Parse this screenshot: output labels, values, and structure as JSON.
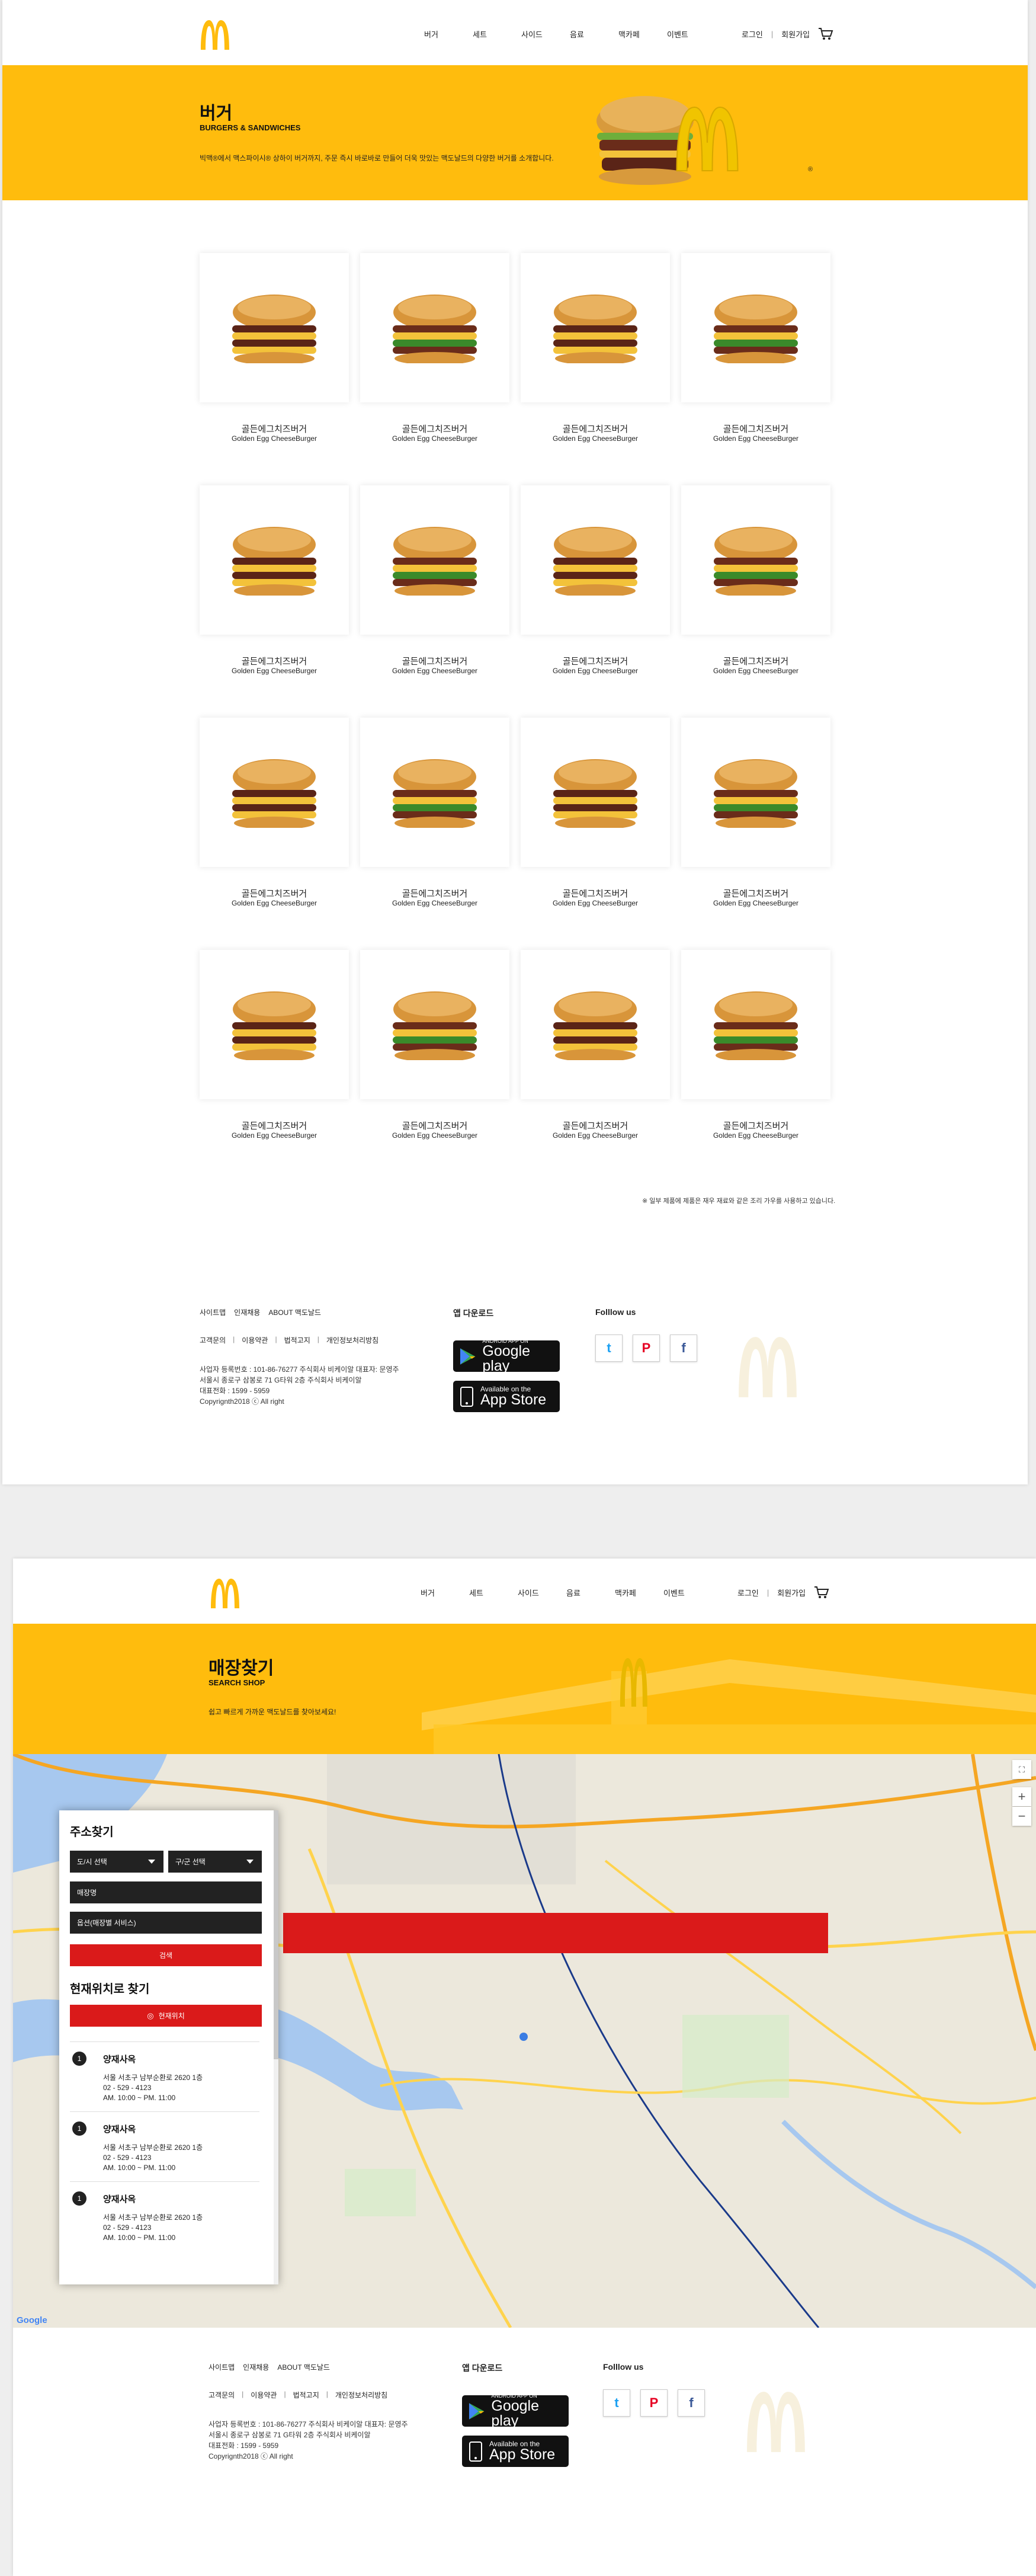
{
  "brand": {
    "yellow": "#ffbc0d",
    "red": "#da1a1a",
    "logo": "golden-arches-logo"
  },
  "nav": [
    "버거",
    "세트",
    "사이드",
    "음료",
    "맥카페",
    "이벤트"
  ],
  "util": {
    "login": "로그인",
    "signup": "회원가입",
    "cart_icon": "cart-icon"
  },
  "menu_page": {
    "hero": {
      "title": "버거",
      "subtitle": "BURGERS & SANDWICHES",
      "desc": "빅맥®에서 맥스파이시® 상하이 버거까지, 주문 즉시 바로바로 만들어 더욱 맛있는 맥도날드의 다양한 버거를 소개합니다."
    },
    "products": [
      {
        "kr": "골든에그치즈버거",
        "en": "Golden Egg CheeseBurger"
      },
      {
        "kr": "골든에그치즈버거",
        "en": "Golden Egg CheeseBurger"
      },
      {
        "kr": "골든에그치즈버거",
        "en": "Golden Egg CheeseBurger"
      },
      {
        "kr": "골든에그치즈버거",
        "en": "Golden Egg CheeseBurger"
      },
      {
        "kr": "골든에그치즈버거",
        "en": "Golden Egg CheeseBurger"
      },
      {
        "kr": "골든에그치즈버거",
        "en": "Golden Egg CheeseBurger"
      },
      {
        "kr": "골든에그치즈버거",
        "en": "Golden Egg CheeseBurger"
      },
      {
        "kr": "골든에그치즈버거",
        "en": "Golden Egg CheeseBurger"
      },
      {
        "kr": "골든에그치즈버거",
        "en": "Golden Egg CheeseBurger"
      },
      {
        "kr": "골든에그치즈버거",
        "en": "Golden Egg CheeseBurger"
      },
      {
        "kr": "골든에그치즈버거",
        "en": "Golden Egg CheeseBurger"
      },
      {
        "kr": "골든에그치즈버거",
        "en": "Golden Egg CheeseBurger"
      },
      {
        "kr": "골든에그치즈버거",
        "en": "Golden Egg CheeseBurger"
      },
      {
        "kr": "골든에그치즈버거",
        "en": "Golden Egg CheeseBurger"
      },
      {
        "kr": "골든에그치즈버거",
        "en": "Golden Egg CheeseBurger"
      },
      {
        "kr": "골든에그치즈버거",
        "en": "Golden Egg CheeseBurger"
      }
    ],
    "note": "※ 일부 제품에 제품은 재우 재료와 같은 조리 가우를 사용하고 있습니다."
  },
  "store_page": {
    "hero": {
      "title": "매장찾기",
      "subtitle": "SEARCH SHOP",
      "desc": "쉽고 빠르게 가까운 맥도날드를 찾아보세요!"
    },
    "panel": {
      "title": "주소찾기",
      "select_city": "도/시 선택",
      "select_district": "구/군 선택",
      "store_name_placeholder": "매장명",
      "service_placeholder": "옵션(매장별 서비스)",
      "search_btn": "검색",
      "current_title": "현재위치로 찾기",
      "current_btn": "현재위치",
      "stores": [
        {
          "num": "1",
          "name": "양재사옥",
          "addr": "서울 서초구 남부순환로 2620 1층",
          "tel": "02 - 529 - 4123",
          "hours": "AM. 10:00 ~ PM. 11:00"
        },
        {
          "num": "1",
          "name": "양재사옥",
          "addr": "서울 서초구 남부순환로 2620 1층",
          "tel": "02 - 529 - 4123",
          "hours": "AM. 10:00 ~ PM. 11:00"
        },
        {
          "num": "1",
          "name": "양재사옥",
          "addr": "서울 서초구 남부순환로 2620 1층",
          "tel": "02 - 529 - 4123",
          "hours": "AM. 10:00 ~ PM. 11:00"
        }
      ]
    },
    "map_brand": "Google"
  },
  "footer": {
    "links1": [
      "사이트맵",
      "인재채용",
      "ABOUT 맥도날드"
    ],
    "links2": [
      "고객문의",
      "이용약관",
      "법적고지",
      "개인정보처리방침"
    ],
    "info": [
      "사업자 등록번호 : 101-86-76277       주식회사 비케이알 대표자: 문영주",
      "서울시 종로구 삼봉로 71 G타워 2층 주식회사 비케이알",
      "대표전화 : 1599 - 5959",
      "Copyrignth2018 ⓒ All right"
    ],
    "app_title": "앱 다운로드",
    "google": {
      "small": "ANDROID APP ON",
      "big": "Google play"
    },
    "apple": {
      "small": "Available on the",
      "big": "App Store"
    },
    "follow": "Folllow us"
  }
}
